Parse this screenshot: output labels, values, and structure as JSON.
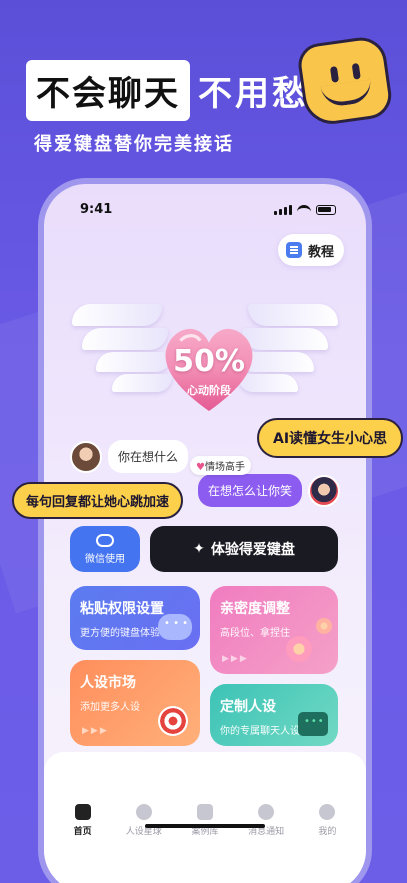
{
  "hero": {
    "title_boxed": "不会聊天",
    "title_rest": "不用愁",
    "subtitle": "得爱键盘替你完美接话"
  },
  "status_bar": {
    "time": "9:41"
  },
  "tutorial": {
    "label": "教程"
  },
  "heart": {
    "percent": "50%",
    "label": "心动阶段"
  },
  "callouts": {
    "ai": "AI读懂女生小心思",
    "reply": "每句回复都让她心跳加速"
  },
  "chat": {
    "left_msg": "你在想什么",
    "right_msg": "在想怎么让你笑",
    "right_tag": "情场高手"
  },
  "actions": {
    "wechat_label": "微信使用",
    "try_label": "体验得爱键盘"
  },
  "cards": [
    {
      "title": "粘贴权限设置",
      "sub": "更方便的键盘体验"
    },
    {
      "title": "亲密度调整",
      "sub": "高段位、拿捏住"
    },
    {
      "title": "人设市场",
      "sub": "添加更多人设"
    },
    {
      "title": "定制人设",
      "sub": "你的专属聊天人设"
    }
  ],
  "tabs": [
    {
      "label": "首页",
      "active": true
    },
    {
      "label": "人设星球"
    },
    {
      "label": "案例库"
    },
    {
      "label": "消息通知"
    },
    {
      "label": "我的"
    }
  ],
  "colors": {
    "background": "#5b4fd8",
    "callout": "#fcd04b",
    "accent_purple": "#8c5cf0",
    "wechat_blue": "#4474ef"
  }
}
